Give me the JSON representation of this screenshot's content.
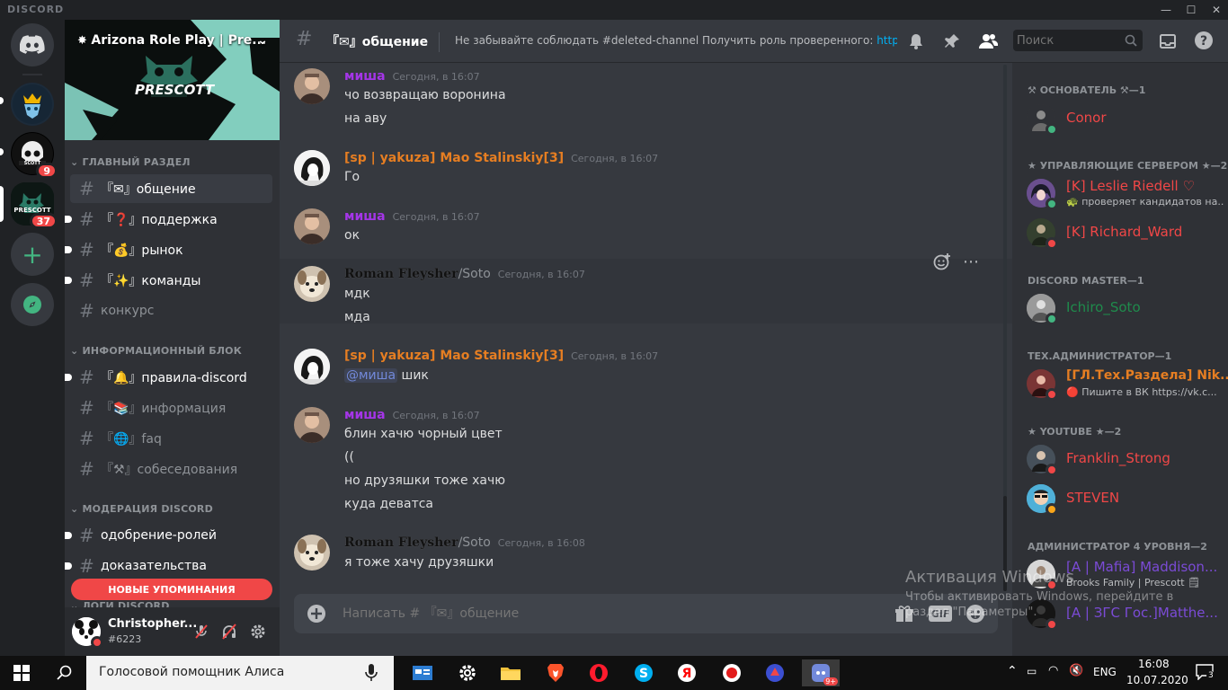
{
  "app": {
    "brand": "DISCORD"
  },
  "titlebar": {
    "minimize": "—",
    "maximize": "☐",
    "close": "✕"
  },
  "guilds": {
    "badge_1": "9",
    "badge_2": "37",
    "add": "+"
  },
  "server": {
    "name": "Arizona Role Play | Pre...",
    "logo_text": "PRESCOTT"
  },
  "categories": [
    {
      "label": "ГЛАВНЫЙ РАЗДЕЛ"
    },
    {
      "label": "ИНФОРМАЦИОННЫЙ БЛОК"
    },
    {
      "label": "МОДЕРАЦИЯ DISCORD"
    },
    {
      "label": "ЛОГИ DISCORD"
    }
  ],
  "channels": [
    {
      "label": "『✉』общение"
    },
    {
      "label": "『❓』поддержка"
    },
    {
      "label": "『💰』рынок"
    },
    {
      "label": "『✨』команды"
    },
    {
      "label": "конкурс"
    },
    {
      "label": "『🔔』правила-discord"
    },
    {
      "label": "『📚』информация"
    },
    {
      "label": "『🌐』faq"
    },
    {
      "label": "『⚒』собеседования"
    },
    {
      "label": "одобрение-ролей"
    },
    {
      "label": "доказательства"
    }
  ],
  "mentions_pill": "НОВЫЕ УПОМИНАНИЯ",
  "user": {
    "name": "Christopher...",
    "tag": "#6223"
  },
  "header": {
    "channel": "『✉』общение",
    "topic": "Не забывайте соблюдать #deleted-channel Получить роль проверенного: ",
    "topic_link": "https...",
    "search_placeholder": "Поиск"
  },
  "messages": [
    {
      "author": "миша",
      "time": "Сегодня, в 16:07",
      "lines": [
        "чо возвращаю воронина",
        "на аву"
      ]
    },
    {
      "author": "[sp | yakuza] Mao Stalinskiy[3]",
      "time": "Сегодня, в 16:07",
      "lines": [
        "Го"
      ]
    },
    {
      "author": "миша",
      "time": "Сегодня, в 16:07",
      "lines": [
        "ок"
      ]
    },
    {
      "author": "Roman Fleysher",
      "author_suffix": "/Soto",
      "time": "Сегодня, в 16:07",
      "lines": [
        "мдк",
        "мда"
      ]
    },
    {
      "author": "[sp | yakuza] Mao Stalinskiy[3]",
      "time": "Сегодня, в 16:07",
      "mention": "@миша",
      "lines": [
        " шик"
      ]
    },
    {
      "author": "миша",
      "time": "Сегодня, в 16:07",
      "lines": [
        "блин хачю чорный цвет",
        "((",
        "но друзяшки тоже хачю",
        "куда деватса"
      ]
    },
    {
      "author": "Roman Fleysher",
      "author_suffix": "/Soto",
      "time": "Сегодня, в 16:08",
      "lines": [
        "я тоже хачу друзяшки"
      ]
    }
  ],
  "composer": {
    "placeholder": "Написать # 『✉』общение",
    "gif": "GIF"
  },
  "member_roles": [
    {
      "label": "⚒ ОСНОВАТЕЛЬ ⚒—1"
    },
    {
      "label": "★ УПРАВЛЯЮЩИЕ СЕРВЕРОМ ★—2"
    },
    {
      "label": "DISCORD MASTER—1"
    },
    {
      "label": "ТЕХ.АДМИНИСТРАТОР—1"
    },
    {
      "label": "★ YOUTUBE ★—2"
    },
    {
      "label": "АДМИНИСТРАТОР 4 УРОВНЯ—2"
    }
  ],
  "members": [
    {
      "name": "Conor",
      "status": "",
      "color": "#f04747"
    },
    {
      "name": "[K] Leslie Riedell ♡",
      "status": "🐢 проверяет кандидатов на...",
      "color": "#f04747"
    },
    {
      "name": "[K] Richard_Ward",
      "status": "",
      "color": "#f04747"
    },
    {
      "name": "Ichiro_Soto",
      "status": "",
      "color": "#1f8b4c"
    },
    {
      "name": "[ГЛ.Тех.Раздела] Nik...",
      "status": "🔴 Пишите в ВК https://vk.c...",
      "color": "#e67e22"
    },
    {
      "name": "Franklin_Strong",
      "status": "",
      "color": "#f04747"
    },
    {
      "name": "STEVEN",
      "status": "",
      "color": "#f04747"
    },
    {
      "name": "[A | Mafia] Maddison...",
      "status": "Brooks Family | Prescott 🗒",
      "color": "#7b4bd6"
    },
    {
      "name": "[A | ЗГС Гос.]Matthe...",
      "status": "",
      "color": "#7b4bd6"
    }
  ],
  "watermark": {
    "line1": "Активация Windows",
    "line2": "Чтобы активировать Windows, перейдите в",
    "line3": "раздел \"Параметры\"."
  },
  "taskbar": {
    "search_text": "Голосовой помощник Алиса",
    "lang": "ENG",
    "time": "16:08",
    "date": "10.07.2020",
    "notif_count": "3",
    "discord_badge": "9+"
  },
  "colors": {
    "misha": "#a535e8",
    "yakuza": "#e67e22",
    "roman": "#b9bbbe",
    "mention_bg": "#f04747",
    "online": "#43b581",
    "dnd": "#f04747",
    "idle": "#faa61a",
    "blurple": "#7289da"
  }
}
